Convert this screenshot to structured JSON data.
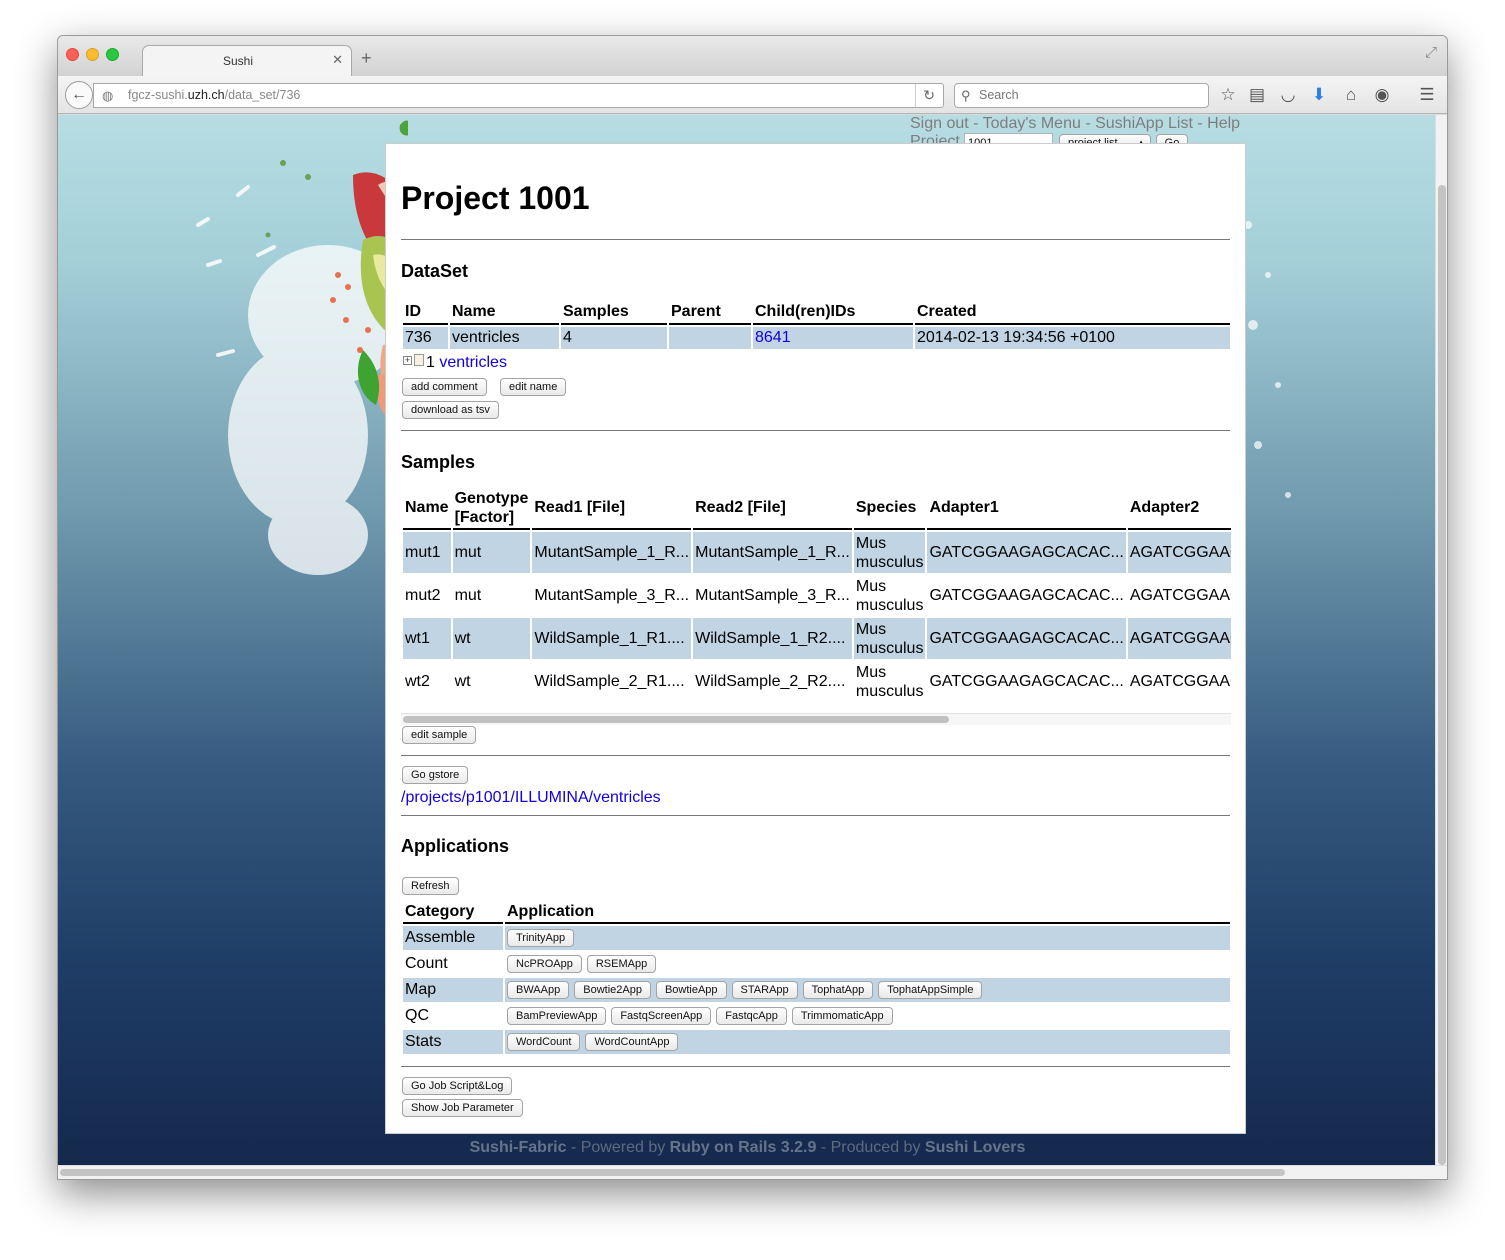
{
  "browser": {
    "tab_title": "Sushi",
    "url_prefix": "fgcz-sushi.",
    "url_domain": "uzh.ch",
    "url_path": "/data_set/736",
    "search_placeholder": "Search"
  },
  "header_nav": {
    "sign_out": "Sign out",
    "todays_menu": "Today's Menu",
    "sushiapp_list": "SushiApp List",
    "help": "Help",
    "separator": " - ",
    "project_label": "Project",
    "project_value": "1001",
    "project_select": "project list",
    "go": "Go"
  },
  "page": {
    "title": "Project 1001"
  },
  "dataset": {
    "heading": "DataSet",
    "columns": [
      "ID",
      "Name",
      "Samples",
      "Parent",
      "Child(ren)IDs",
      "Created"
    ],
    "row": {
      "id": "736",
      "name": "ventricles",
      "samples": "4",
      "parent": "",
      "children": "8641",
      "created": "2014-02-13 19:34:56 +0100"
    },
    "tree_count": "1",
    "tree_name": "ventricles",
    "buttons": {
      "add_comment": "add comment",
      "edit_name": "edit name",
      "download_tsv": "download as tsv"
    }
  },
  "samples": {
    "heading": "Samples",
    "columns": [
      "Name",
      "Genotype [Factor]",
      "Read1 [File]",
      "Read2 [File]",
      "Species",
      "Adapter1",
      "Adapter2"
    ],
    "rows": [
      [
        "mut1",
        "mut",
        "MutantSample_1_R...",
        "MutantSample_1_R...",
        "Mus musculus",
        "GATCGGAAGAGCACAC...",
        "AGATCGGAAGAGCGT"
      ],
      [
        "mut2",
        "mut",
        "MutantSample_3_R...",
        "MutantSample_3_R...",
        "Mus musculus",
        "GATCGGAAGAGCACAC...",
        "AGATCGGAAGAGCGT"
      ],
      [
        "wt1",
        "wt",
        "WildSample_1_R1....",
        "WildSample_1_R2....",
        "Mus musculus",
        "GATCGGAAGAGCACAC...",
        "AGATCGGAAGAGCGT"
      ],
      [
        "wt2",
        "wt",
        "WildSample_2_R1....",
        "WildSample_2_R2....",
        "Mus musculus",
        "GATCGGAAGAGCACAC...",
        "AGATCGGAAGAGCGT"
      ]
    ],
    "edit_sample": "edit sample"
  },
  "gstore": {
    "button": "Go gstore",
    "path": "/projects/p1001/ILLUMINA/ventricles"
  },
  "applications": {
    "heading": "Applications",
    "refresh": "Refresh",
    "columns": [
      "Category",
      "Application"
    ],
    "rows": [
      {
        "category": "Assemble",
        "apps": [
          "TrinityApp"
        ]
      },
      {
        "category": "Count",
        "apps": [
          "NcPROApp",
          "RSEMApp"
        ]
      },
      {
        "category": "Map",
        "apps": [
          "BWAApp",
          "Bowtie2App",
          "BowtieApp",
          "STARApp",
          "TophatApp",
          "TophatAppSimple"
        ]
      },
      {
        "category": "QC",
        "apps": [
          "BamPreviewApp",
          "FastqScreenApp",
          "FastqcApp",
          "TrimmomaticApp"
        ]
      },
      {
        "category": "Stats",
        "apps": [
          "WordCount",
          "WordCountApp"
        ]
      }
    ]
  },
  "job_buttons": {
    "script_log": "Go Job Script&Log",
    "show_param": "Show Job Parameter"
  },
  "footer": {
    "sushi_fabric": "Sushi-Fabric",
    "powered_by": " - Powered by ",
    "rails": "Ruby on Rails 3.2.9",
    "produced_by": " - Produced by ",
    "lovers": "Sushi Lovers"
  }
}
